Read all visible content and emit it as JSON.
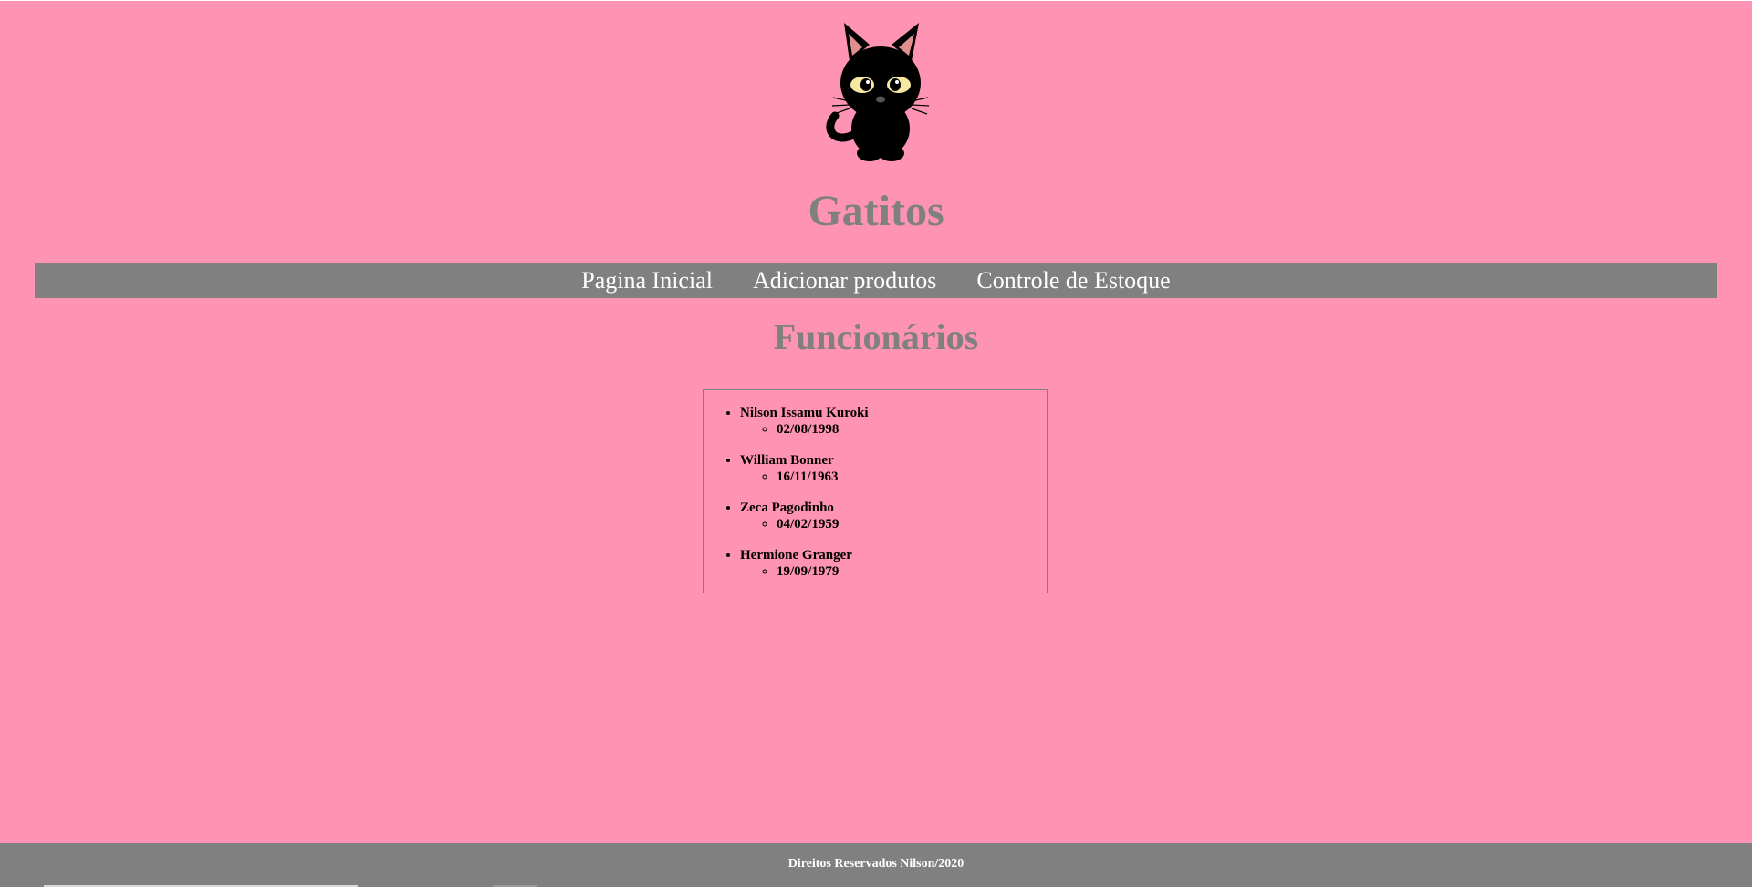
{
  "header": {
    "logo_icon": "black-cat-icon",
    "title": "Gatitos"
  },
  "nav": {
    "items": [
      {
        "label": "Pagina Inicial"
      },
      {
        "label": "Adicionar produtos"
      },
      {
        "label": "Controle de Estoque"
      }
    ]
  },
  "main": {
    "title": "Funcionários",
    "employees": [
      {
        "name": "Nilson Issamu Kuroki",
        "birth": "02/08/1998"
      },
      {
        "name": "William Bonner",
        "birth": "16/11/1963"
      },
      {
        "name": "Zeca Pagodinho",
        "birth": "04/02/1959"
      },
      {
        "name": "Hermione Granger",
        "birth": "19/09/1979"
      }
    ]
  },
  "footer": {
    "text": "Direitos Reservados Nilson/2020"
  },
  "colors": {
    "background": "#ff93b3",
    "accent": "#808080",
    "text_light": "#ffffff"
  }
}
